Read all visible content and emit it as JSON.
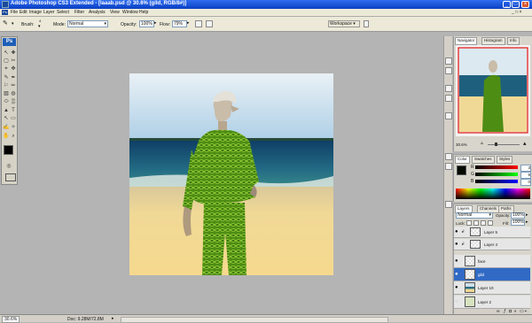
{
  "window": {
    "title": "Adobe Photoshop CS3 Extended - [laaab.psd @ 30.6% (gild, RGB/8#)]"
  },
  "menu": [
    "File",
    "Edit",
    "Image",
    "Layer",
    "Select",
    "Filter",
    "Analysis",
    "View",
    "Window",
    "Help"
  ],
  "options": {
    "brush_label": "Brush:",
    "brush_size": "4",
    "mode_label": "Mode:",
    "mode_value": "Normal",
    "opacity_label": "Opacity:",
    "opacity_value": "100%",
    "flow_label": "Flow:",
    "flow_value": "79%",
    "workspace_label": "Workspace ▾"
  },
  "toolbox": {
    "logo": "Ps",
    "tools": [
      "↖",
      "✚",
      "▢",
      "✂",
      "⌖",
      "✥",
      "✎",
      "✒",
      "⚐",
      "✏",
      "▧",
      "◍",
      "⬭",
      "▒",
      "▲",
      "♩",
      "✍",
      "✧",
      "T",
      "↖",
      "▭",
      "✋",
      "⌕",
      "◎"
    ]
  },
  "navigator": {
    "tabs": [
      "Navigator",
      "Histogram",
      "Info"
    ],
    "zoom": "30.6%"
  },
  "color": {
    "tabs": [
      "Color",
      "Swatches",
      "Styles"
    ],
    "channels": [
      {
        "label": "R",
        "value": "3"
      },
      {
        "label": "G",
        "value": "9"
      },
      {
        "label": "B",
        "value": "0"
      }
    ]
  },
  "layers": {
    "tabs": [
      "Layers",
      "Channels",
      "Paths"
    ],
    "blend_mode": "Normal",
    "opacity_label": "Opacity:",
    "opacity_value": "100%",
    "lock_label": "Lock:",
    "fill_label": "Fill:",
    "fill_value": "100%",
    "items": [
      {
        "name": "Layer 5"
      },
      {
        "name": "Layer 4"
      },
      {
        "name": "face"
      },
      {
        "name": "gild"
      },
      {
        "name": "Layer 10"
      },
      {
        "name": "Layer 2"
      }
    ]
  },
  "status": {
    "zoom": "30.6%",
    "doc": "Doc: 9.28M/72.8M"
  }
}
